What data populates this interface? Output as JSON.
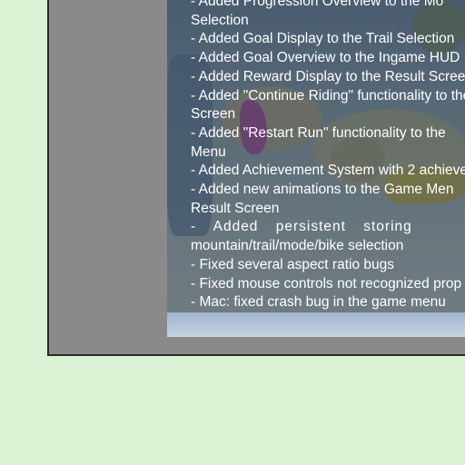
{
  "changelog": {
    "lines": [
      "- Added Progression Overview to the Mo",
      "Selection",
      "- Added Goal Display to the Trail Selection",
      "- Added Goal Overview to the Ingame HUD",
      "- Added Reward Display to the Result Screen",
      "- Added \"Continue Riding\" functionality to the",
      "Screen",
      "- Added \"Restart Run\" functionality to the",
      "Menu",
      "- Added Achievement System with 2 achieve",
      "- Added new animations to the Game Men",
      "Result Screen",
      "- Added persistent storing",
      "mountain/trail/mode/bike selection",
      "- Fixed several aspect ratio bugs",
      "- Fixed mouse controls not recognized prop",
      "- Mac: fixed crash bug in the game menu"
    ]
  }
}
